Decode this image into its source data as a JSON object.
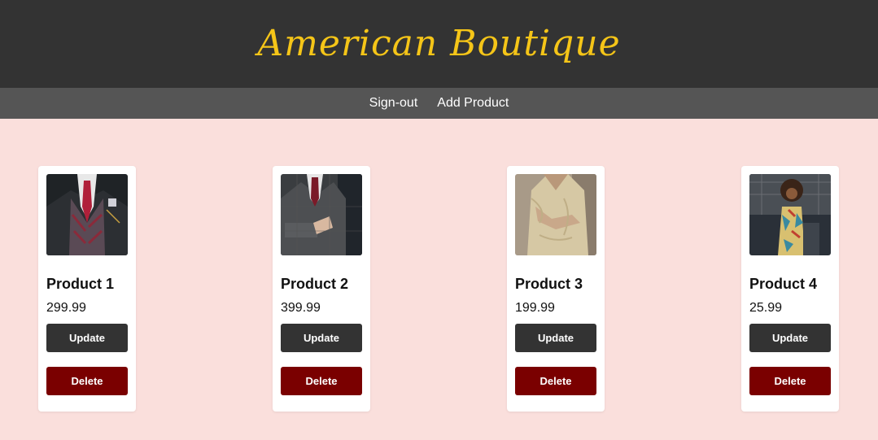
{
  "header": {
    "brand": "American Boutique"
  },
  "nav": {
    "signout_label": "Sign-out",
    "add_product_label": "Add Product"
  },
  "products": [
    {
      "name": "Product 1",
      "price": "299.99",
      "update_label": "Update",
      "delete_label": "Delete"
    },
    {
      "name": "Product 2",
      "price": "399.99",
      "update_label": "Update",
      "delete_label": "Delete"
    },
    {
      "name": "Product 3",
      "price": "199.99",
      "update_label": "Update",
      "delete_label": "Delete"
    },
    {
      "name": "Product 4",
      "price": "25.99",
      "update_label": "Update",
      "delete_label": "Delete"
    }
  ],
  "colors": {
    "header_bg": "#333333",
    "nav_bg": "#555555",
    "brand": "#f5c518",
    "page_bg": "#fadfdc",
    "update_btn": "#333333",
    "delete_btn": "#7a0000"
  }
}
